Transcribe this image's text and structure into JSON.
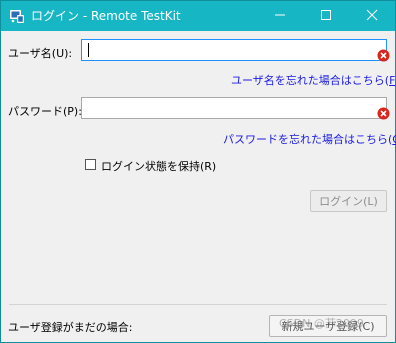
{
  "window": {
    "title": "ログイン - Remote TestKit"
  },
  "form": {
    "username_label": "ユーザ名(U):",
    "username_value": "",
    "forgot_username_link_prefix": "ユーザ名を忘れた場合はこちら(",
    "forgot_username_link_key": "F",
    "forgot_username_link_suffix": ")",
    "password_label": "パスワード(P):",
    "password_value": "",
    "forgot_password_link_prefix": "パスワードを忘れた場合はこちら(",
    "forgot_password_link_key": "O",
    "forgot_password_link_suffix": ")",
    "keep_login_label": "ログイン状態を保持(R)",
    "keep_login_checked": false,
    "login_button": "ログイン(L)"
  },
  "footer": {
    "not_registered_label": "ユーザ登録がまだの場合:",
    "new_user_button": "新規ユーザ登録(C)",
    "watermark": "CSDN @苏2099"
  },
  "colors": {
    "titlebar": "#17b6c4",
    "link": "#1a1ae6",
    "error_icon": "#d9261c",
    "field_focus_border": "#1e90ff"
  },
  "icons": {
    "app": "remote-testkit-app-icon",
    "minimize": "minimize-icon",
    "maximize": "maximize-icon",
    "close": "close-icon",
    "error": "error-icon"
  }
}
